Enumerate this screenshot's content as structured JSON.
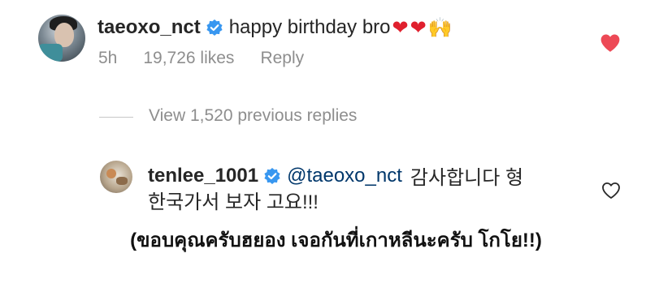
{
  "comment": {
    "username": "taeoxo_nct",
    "text": "happy birthday bro",
    "emojis": [
      "❤",
      "❤",
      "🙌"
    ],
    "time": "5h",
    "likes": "19,726 likes",
    "reply_label": "Reply",
    "liked": true
  },
  "view_replies": "View 1,520 previous replies",
  "reply": {
    "username": "tenlee_1001",
    "mention": "@taeoxo_nct",
    "text_line1": "감사합니다 형",
    "text_line2": "한국가서 보자 고요!!!",
    "liked": false
  },
  "translation": "(ขอบคุณครับฮยอง เจอกันที่เกาหลีนะครับ โกโย!!)",
  "colors": {
    "heart_liked": "#ed4956",
    "mention": "#00376b",
    "muted": "#8e8e8e",
    "verified": "#3897f0"
  }
}
